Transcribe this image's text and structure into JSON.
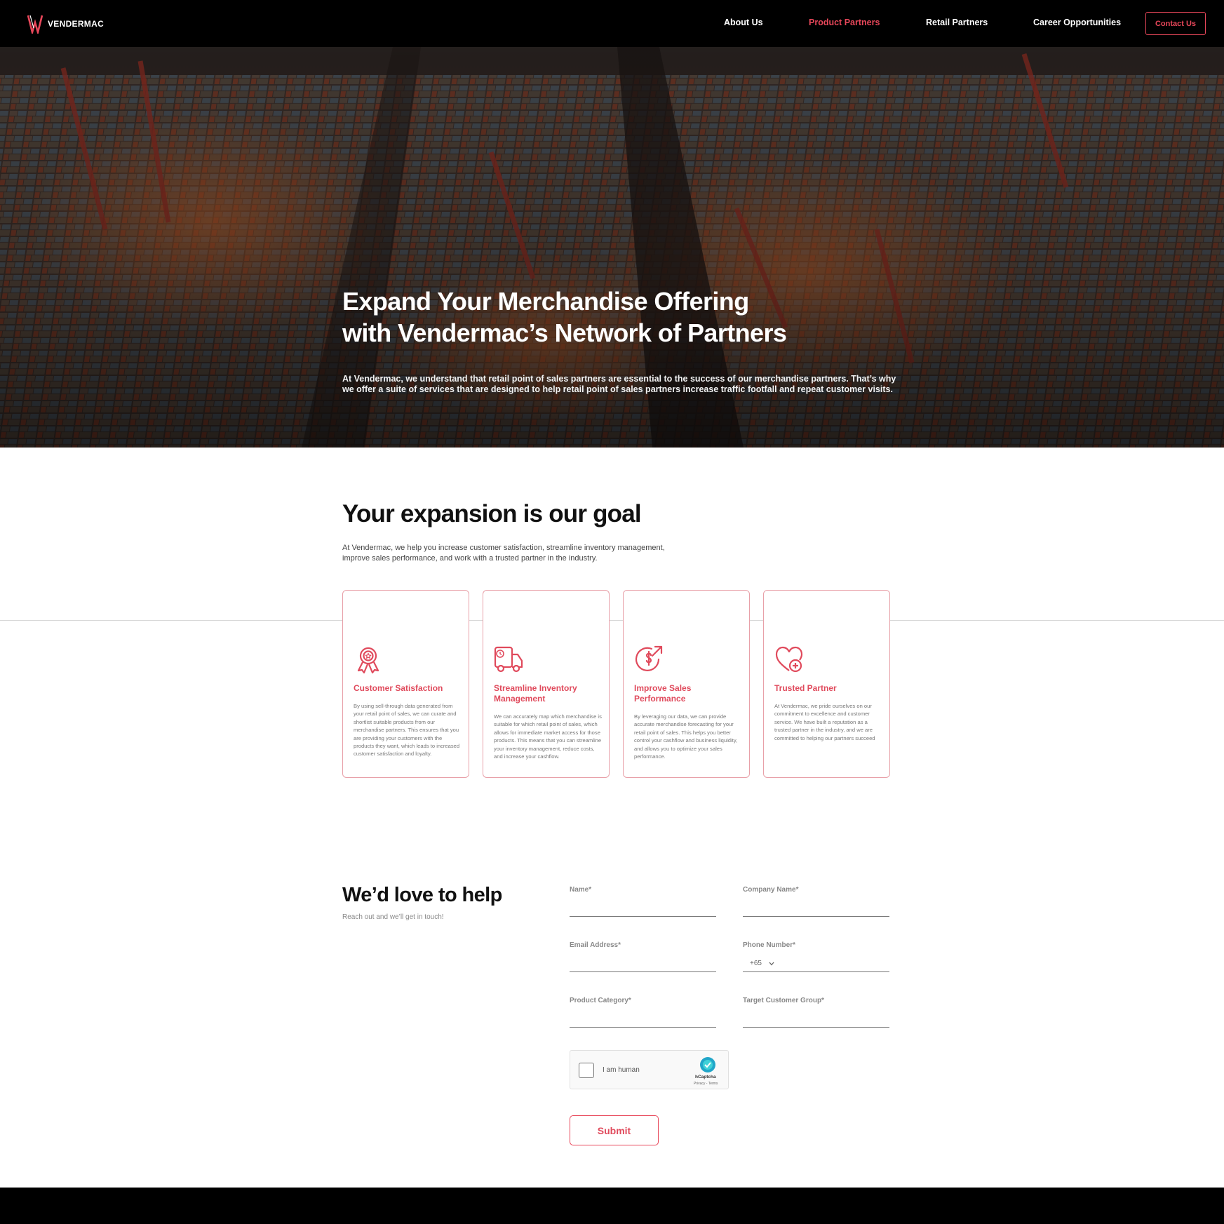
{
  "nav": {
    "logo_text": "VENDERMAC",
    "links": [
      "About Us",
      "Product Partners",
      "Retail Partners",
      "Career Opportunities"
    ],
    "active_link": "Product Partners",
    "contact_label": "Contact Us"
  },
  "hero": {
    "title_line1": "Expand Your Merchandise Offering",
    "title_line2": "with Vendermac’s Network of Partners",
    "description_line1": "At Vendermac, we understand that retail point of sales partners are essential to the success of our merchandise partners. That’s why",
    "description_line2": "we offer a suite of services that are designed to help retail point of sales partners increase traffic footfall and repeat customer visits."
  },
  "goal": {
    "title": "Your expansion is our goal",
    "description_line1": "At Vendermac, we help you increase customer satisfaction, streamline inventory management,",
    "description_line2": "improve sales performance, and work with a trusted partner in the industry."
  },
  "cards": [
    {
      "icon": "award-icon",
      "title": "Customer Satisfaction",
      "text": "By using sell-through data generated from your retail point of sales, we can curate and shortlist suitable products from our merchandise partners. This ensures that you are providing your customers with the products they want, which leads to increased customer satisfaction and loyalty."
    },
    {
      "icon": "delivery-truck-icon",
      "title": "Streamline Inventory Management",
      "text": "We can accurately map which merchandise is suitable for which retail point of sales, which allows for immediate market access for those products. This means that you can streamline your inventory management, reduce costs, and increase your cashflow."
    },
    {
      "icon": "dollar-growth-icon",
      "title": "Improve Sales Performance",
      "text": "By leveraging our data, we can provide accurate merchandise forecasting for your retail point of sales. This helps you better control your cashflow and business liquidity, and allows you to optimize your sales performance."
    },
    {
      "icon": "heart-plus-icon",
      "title": "Trusted Partner",
      "text": "At Vendermac, we pride ourselves on our commitment to excellence and customer service. We have built a reputation as a trusted partner in the industry, and we are committed to helping our partners succeed"
    }
  ],
  "form": {
    "title": "We’d love to help",
    "subtitle": "Reach out and we’ll get in touch!",
    "fields": {
      "name": "Name*",
      "company": "Company Name*",
      "email": "Email Address*",
      "phone": "Phone Number*",
      "category": "Product Category*",
      "target": "Target Customer Group*"
    },
    "phone_code": "+65",
    "captcha": {
      "label": "I am human",
      "brand": "hCaptcha",
      "links": "Privacy - Terms"
    },
    "submit_label": "Submit"
  },
  "colors": {
    "accent": "#e8475a",
    "card_border": "#e8a0a8",
    "nav_bg": "#000000"
  }
}
